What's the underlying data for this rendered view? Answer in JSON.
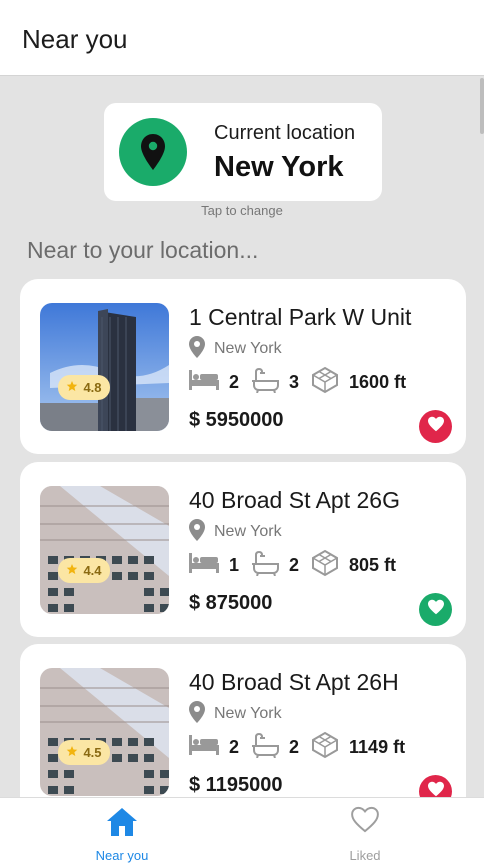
{
  "header": {
    "title": "Near you"
  },
  "location": {
    "label": "Current location",
    "city": "New York",
    "hint": "Tap to change"
  },
  "section_title": "Near to your location...",
  "colors": {
    "accent_green": "#1aab6a",
    "like_red": "#e0264a",
    "nav_active": "#1e88e5",
    "nav_inactive": "#9e9e9e"
  },
  "listings": [
    {
      "name": "1 Central Park W Unit",
      "city": "New York",
      "beds": "2",
      "baths": "3",
      "area": "1600 ft",
      "price": "$ 5950000",
      "rating": "4.8",
      "liked": true
    },
    {
      "name": "40 Broad St Apt 26G",
      "city": "New York",
      "beds": "1",
      "baths": "2",
      "area": "805 ft",
      "price": "$ 875000",
      "rating": "4.4",
      "liked": false
    },
    {
      "name": "40 Broad St Apt 26H",
      "city": "New York",
      "beds": "2",
      "baths": "2",
      "area": "1149 ft",
      "price": "$ 1195000",
      "rating": "4.5",
      "liked": true
    }
  ],
  "bottom_nav": [
    {
      "label": "Near you",
      "icon": "home-icon",
      "active": true
    },
    {
      "label": "Liked",
      "icon": "heart-outline-icon",
      "active": false
    }
  ]
}
